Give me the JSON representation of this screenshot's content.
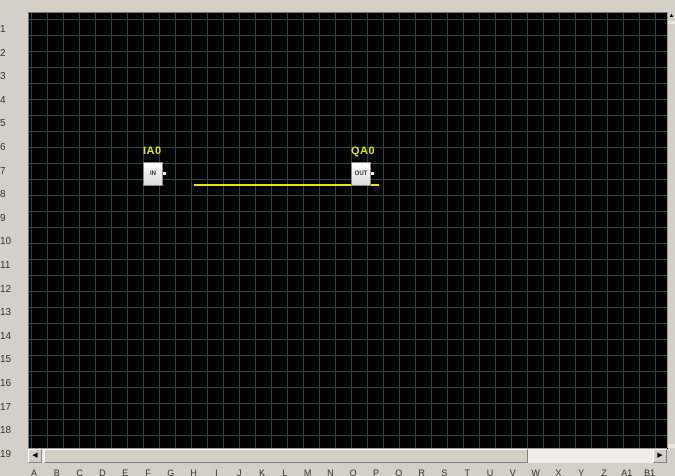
{
  "rulers": {
    "rows": [
      "1",
      "2",
      "3",
      "4",
      "5",
      "6",
      "7",
      "8",
      "9",
      "10",
      "11",
      "12",
      "13",
      "14",
      "15",
      "16",
      "17",
      "18",
      "19"
    ],
    "columns": [
      "A",
      "B",
      "C",
      "D",
      "E",
      "F",
      "G",
      "H",
      "I",
      "J",
      "K",
      "L",
      "M",
      "N",
      "O",
      "P",
      "Q",
      "R",
      "S",
      "T",
      "U",
      "V",
      "W",
      "X",
      "Y",
      "Z",
      "A1",
      "B1"
    ]
  },
  "blocks": {
    "input": {
      "title": "IA0",
      "label": "IN"
    },
    "output": {
      "title": "QA0",
      "label": "OUT"
    }
  },
  "wire": {
    "color": "#e6e600"
  },
  "canvas": {
    "background": "#000000",
    "grid_color": "#1f4a45"
  },
  "scrollbars": {
    "up_icon": "arrow-up-icon",
    "left_icon": "arrow-left-icon",
    "right_icon": "arrow-right-icon"
  }
}
